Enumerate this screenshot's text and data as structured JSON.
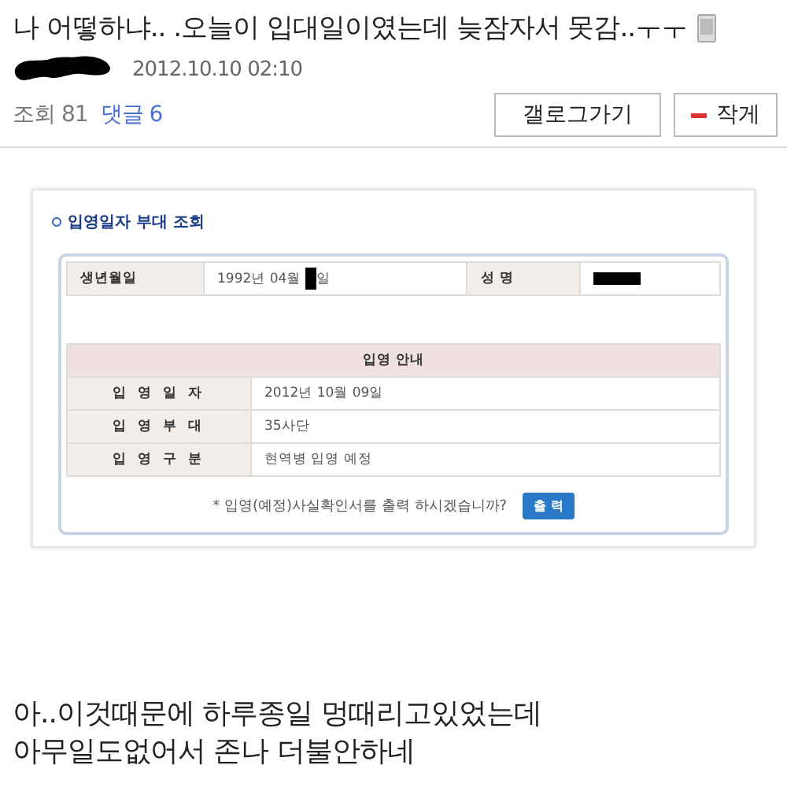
{
  "post": {
    "title": "나 어떻하냐.. .오늘이 입대일이였는데 늦잠자서 못감..ㅜㅜ",
    "date": "2012.10.10 02:10",
    "views": "조회 81",
    "comments": "댓글 6",
    "buttons": [
      {
        "kind": "plain",
        "label": "갤로그가기"
      },
      {
        "kind": "minus",
        "label": "작게"
      }
    ]
  },
  "embedded": {
    "heading": "입영일자 부대 조회",
    "birth_label": "생년월일",
    "birth_month": "1992년 04월",
    "birth_day": "일",
    "name_label": "성 명",
    "notice_title": "입영 안내",
    "rows": [
      {
        "label": "입 영 일 자",
        "value": "2012년 10월 09일"
      },
      {
        "label": "입 영 부 대",
        "value": "35사단"
      },
      {
        "label": "입 영 구 분",
        "value": "현역병 입영 예정"
      }
    ],
    "prompt": "* 입영(예정)사실확인서를 출력 하시겠습니까?",
    "print_button": "출 력"
  },
  "body": [
    "아..이것때문에 하루종일 멍때리고있었는데",
    "아무일도없어서 존나 더불안하네"
  ]
}
